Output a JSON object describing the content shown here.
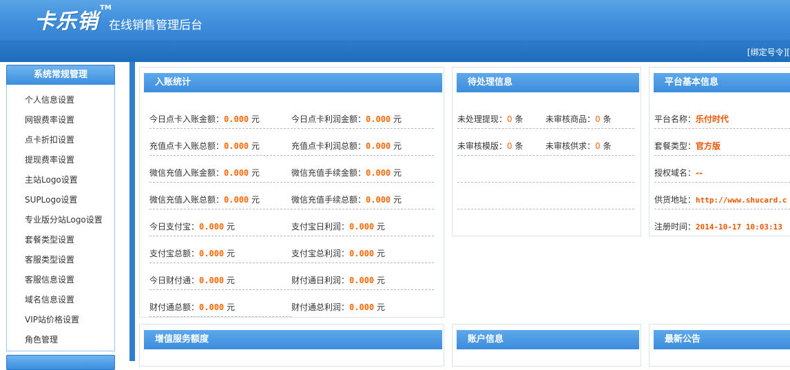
{
  "header": {
    "logo_text": "卡乐销",
    "logo_tm": "TM",
    "subtitle": "在线销售管理后台"
  },
  "topbar": {
    "links_text": "[绑定号令][",
    "link_label": "绑定号令"
  },
  "sidebar": {
    "section1_title": "系统常规管理",
    "items": [
      "个人信息设置",
      "网银费率设置",
      "点卡折扣设置",
      "提现费率设置",
      "主站Logo设置",
      "SUPLogo设置",
      "专业版分站Logo设置",
      "套餐类型设置",
      "客服类型设置",
      "客服信息设置",
      "域名信息设置",
      "VIP站价格设置",
      "角色管理"
    ]
  },
  "panels": {
    "income": {
      "title": "入账统计",
      "unit": "元",
      "rows": [
        {
          "l_label": "今日点卡入账金额：",
          "l_value": "0.000",
          "r_label": "今日点卡利润金额：",
          "r_value": "0.000"
        },
        {
          "l_label": "充值点卡入账总额：",
          "l_value": "0.000",
          "r_label": "充值点卡利润总额：",
          "r_value": "0.000"
        },
        {
          "l_label": "微信充值入账金额：",
          "l_value": "0.000",
          "r_label": "微信充值手续金额：",
          "r_value": "0.000"
        },
        {
          "l_label": "微信充值入账总额：",
          "l_value": "0.000",
          "r_label": "微信充值手续总额：",
          "r_value": "0.000"
        },
        {
          "l_label": "今日支付宝：",
          "l_value": "0.000",
          "r_label": "支付宝日利润：",
          "r_value": "0.000"
        },
        {
          "l_label": "支付宝总额：",
          "l_value": "0.000",
          "r_label": "支付宝总利润：",
          "r_value": "0.000"
        },
        {
          "l_label": "今日财付通：",
          "l_value": "0.000",
          "r_label": "财付通日利润：",
          "r_value": "0.000"
        },
        {
          "l_label": "财付通总额：",
          "l_value": "0.000",
          "r_label": "财付通总利润：",
          "r_value": "0.000"
        }
      ]
    },
    "pending": {
      "title": "待处理信息",
      "unit": "条",
      "rows": [
        {
          "l_label": "未处理提现：",
          "l_value": "0",
          "r_label": "未审核商品：",
          "r_value": "0"
        },
        {
          "l_label": "未审核模版：",
          "l_value": "0",
          "r_label": "未审核供求：",
          "r_value": "0"
        }
      ]
    },
    "platform": {
      "title": "平台基本信息",
      "rows": [
        {
          "label": "平台名称：",
          "value": "乐付时代"
        },
        {
          "label": "套餐类型：",
          "value": "官方版"
        },
        {
          "label": "授权域名：",
          "value": "--"
        },
        {
          "label": "供货地址：",
          "value": "http://www.shucard.c"
        },
        {
          "label": "注册时间：",
          "value": "2014-10-17 10:03:13"
        }
      ]
    },
    "value_added": {
      "title": "增值服务额度"
    },
    "account": {
      "title": "账户信息"
    },
    "notice": {
      "title": "最新公告"
    }
  },
  "colors": {
    "header_blue": "#3f8fdc",
    "accent_orange": "#ff6600",
    "panel_title_blue": "#3c8ddc"
  }
}
